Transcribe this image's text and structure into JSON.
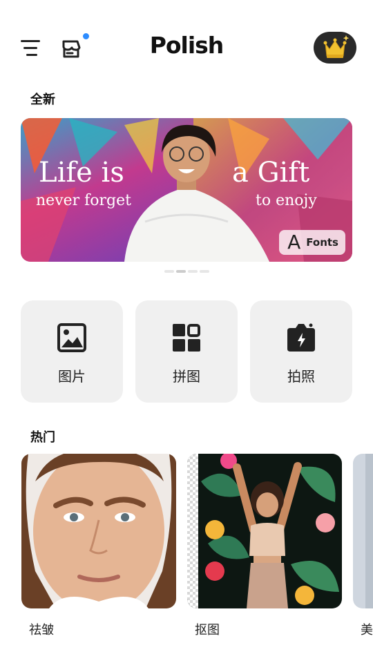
{
  "header": {
    "logo_text": "Polish",
    "icons": {
      "menu": "menu-icon",
      "store": "store-icon",
      "premium": "crown-icon"
    },
    "store_badge_color": "#2d8cff"
  },
  "sections": {
    "new_title": "全新",
    "hot_title": "热门"
  },
  "banner": {
    "headline_left": "Life is",
    "headline_right": "a Gift",
    "subline_left": "never forget",
    "subline_right": "to enojy",
    "tag_glyph": "A",
    "tag_label": "Fonts",
    "page_count": 4,
    "active_page": 2
  },
  "tools": [
    {
      "label": "图片",
      "icon": "image-icon"
    },
    {
      "label": "拼图",
      "icon": "collage-grid-icon"
    },
    {
      "label": "拍照",
      "icon": "camera-flash-icon"
    }
  ],
  "hot": [
    {
      "label": "祛皱"
    },
    {
      "label": "抠图"
    },
    {
      "label": "美"
    }
  ],
  "colors": {
    "tile_bg": "#f0f0f0",
    "crown_bg": "#2a2a2a",
    "crown_gold": "#f2c230"
  }
}
